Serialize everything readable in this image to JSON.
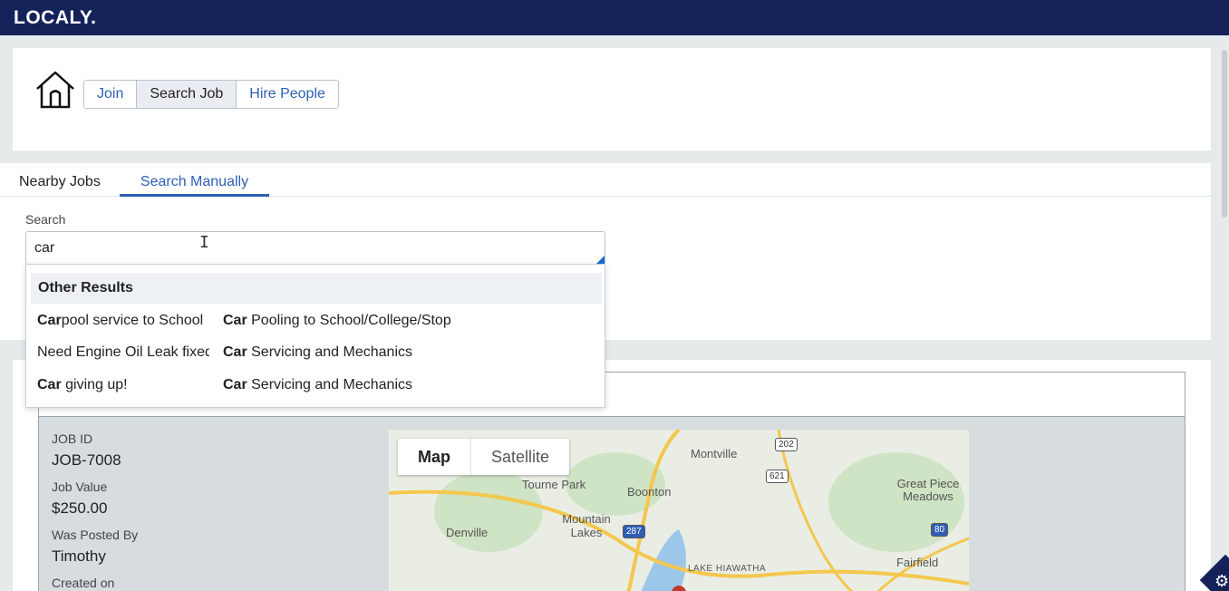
{
  "app": {
    "logo": "LOCALY."
  },
  "nav": {
    "home_icon": "home-icon",
    "buttons": [
      {
        "label": "Join",
        "active": false
      },
      {
        "label": "Search Job",
        "active": true
      },
      {
        "label": "Hire People",
        "active": false
      }
    ]
  },
  "tabs": [
    {
      "label": "Nearby Jobs",
      "active": false
    },
    {
      "label": "Search Manually",
      "active": true
    }
  ],
  "search": {
    "label": "Search",
    "value": "car"
  },
  "dropdown": {
    "header": "Other Results",
    "rows": [
      {
        "c1_bold": "Car",
        "c1_rest": "pool service to School",
        "c2_bold": "Car",
        "c2_rest": " Pooling to School/College/Stop"
      },
      {
        "c1_bold": "",
        "c1_rest": "Need Engine Oil Leak fixed",
        "c2_bold": "Car",
        "c2_rest": " Servicing and Mechanics"
      },
      {
        "c1_bold": "Car",
        "c1_rest": " giving up!",
        "c2_bold": "Car",
        "c2_rest": " Servicing and Mechanics"
      }
    ]
  },
  "job": {
    "id_label": "JOB ID",
    "id_value": "JOB-7008",
    "value_label": "Job Value",
    "value": "$250.00",
    "posted_label": "Was Posted By",
    "posted_value": "Timothy",
    "created_label": "Created on"
  },
  "map": {
    "toggle": [
      "Map",
      "Satellite"
    ],
    "places": [
      "Montville",
      "Tourne Park",
      "Boonton",
      "Great Piece Meadows",
      "Denville",
      "Mountain Lakes",
      "LAKE HIAWATHA",
      "Fairfield"
    ],
    "shields": [
      "202",
      "621",
      "287",
      "80"
    ]
  },
  "colors": {
    "topbar": "#15225a",
    "accent": "#2f5fb5",
    "background": "#e6eaeb"
  }
}
